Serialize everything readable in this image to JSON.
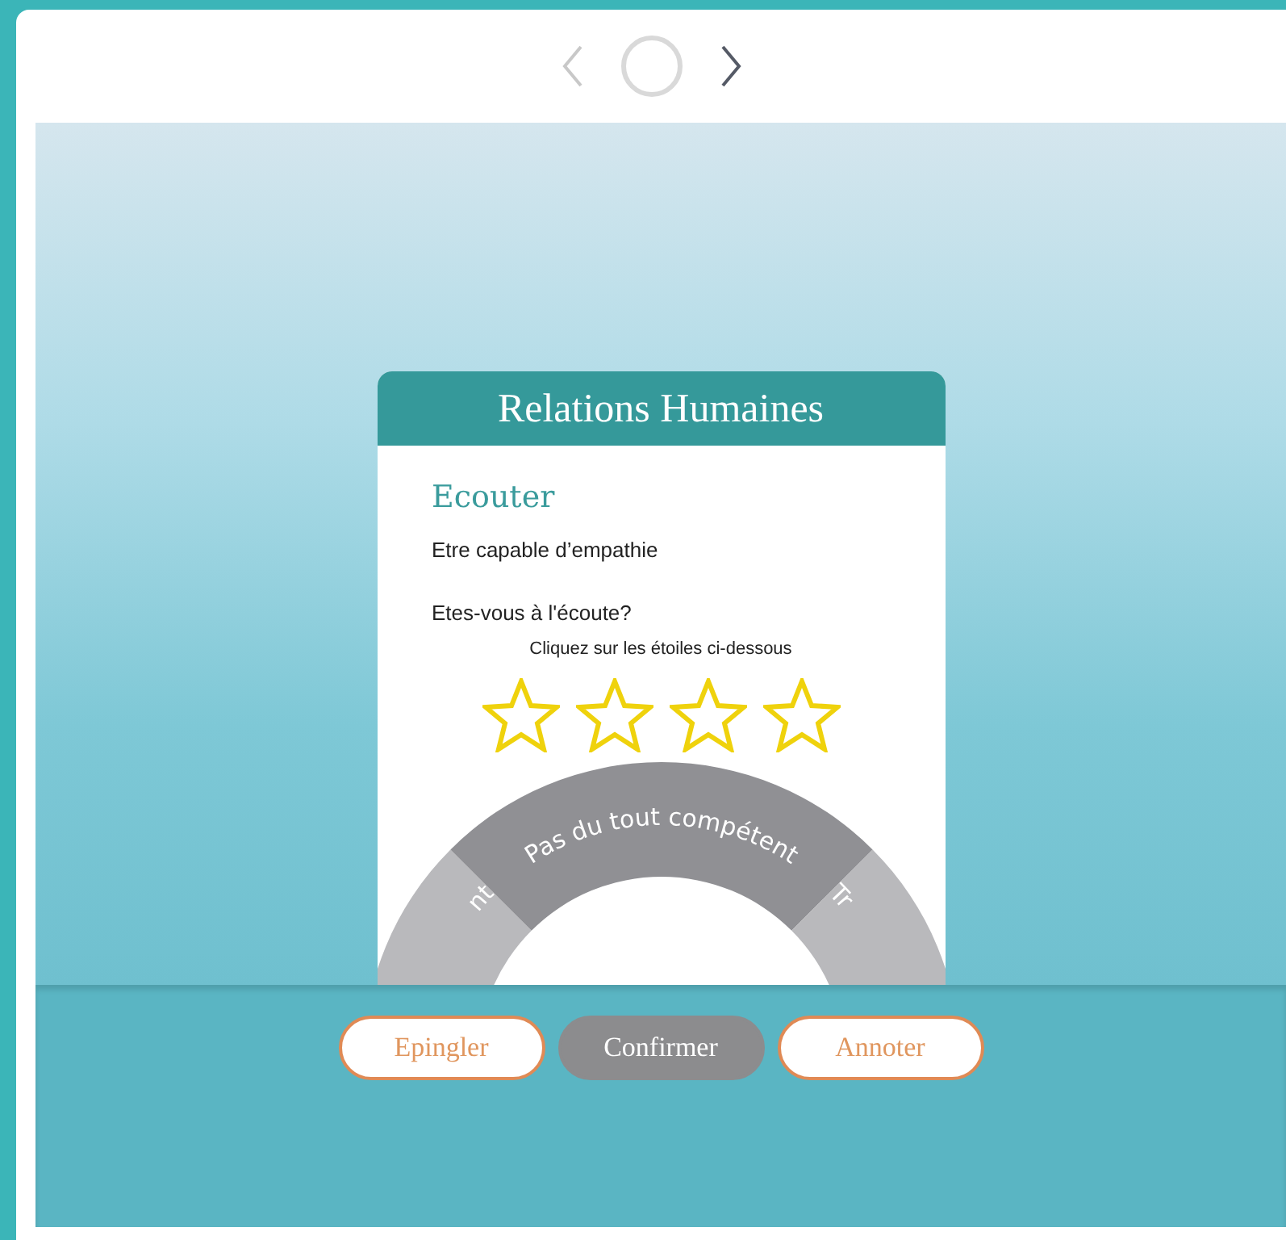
{
  "nav": {
    "prev_disabled": true,
    "next_disabled": false
  },
  "card": {
    "title": "Relations Humaines",
    "skill": "Ecouter",
    "description": "Etre capable d’empathie",
    "question": "Etes-vous à l'écoute?",
    "hint": "Cliquez sur les étoiles ci-dessous",
    "stars": 0,
    "wheel": [
      {
        "label": "nt",
        "selected": false
      },
      {
        "label": "Pas du tout compétent",
        "selected": true
      },
      {
        "label": "Tr",
        "selected": false
      }
    ]
  },
  "buttons": [
    {
      "label": "Epingler",
      "disabled": false
    },
    {
      "label": "Confirmer",
      "disabled": true
    },
    {
      "label": "Annoter",
      "disabled": false
    }
  ]
}
